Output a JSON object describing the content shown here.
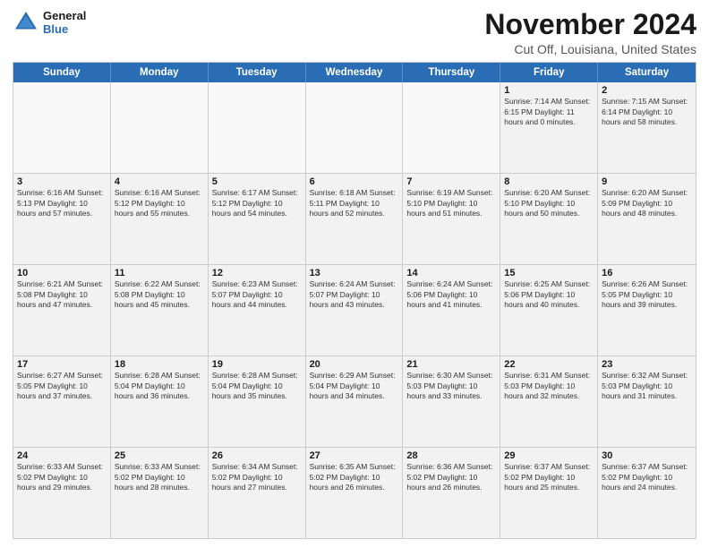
{
  "logo": {
    "line1": "General",
    "line2": "Blue"
  },
  "title": "November 2024",
  "subtitle": "Cut Off, Louisiana, United States",
  "headers": [
    "Sunday",
    "Monday",
    "Tuesday",
    "Wednesday",
    "Thursday",
    "Friday",
    "Saturday"
  ],
  "weeks": [
    [
      {
        "day": "",
        "detail": ""
      },
      {
        "day": "",
        "detail": ""
      },
      {
        "day": "",
        "detail": ""
      },
      {
        "day": "",
        "detail": ""
      },
      {
        "day": "",
        "detail": ""
      },
      {
        "day": "1",
        "detail": "Sunrise: 7:14 AM\nSunset: 6:15 PM\nDaylight: 11 hours\nand 0 minutes."
      },
      {
        "day": "2",
        "detail": "Sunrise: 7:15 AM\nSunset: 6:14 PM\nDaylight: 10 hours\nand 58 minutes."
      }
    ],
    [
      {
        "day": "3",
        "detail": "Sunrise: 6:16 AM\nSunset: 5:13 PM\nDaylight: 10 hours\nand 57 minutes."
      },
      {
        "day": "4",
        "detail": "Sunrise: 6:16 AM\nSunset: 5:12 PM\nDaylight: 10 hours\nand 55 minutes."
      },
      {
        "day": "5",
        "detail": "Sunrise: 6:17 AM\nSunset: 5:12 PM\nDaylight: 10 hours\nand 54 minutes."
      },
      {
        "day": "6",
        "detail": "Sunrise: 6:18 AM\nSunset: 5:11 PM\nDaylight: 10 hours\nand 52 minutes."
      },
      {
        "day": "7",
        "detail": "Sunrise: 6:19 AM\nSunset: 5:10 PM\nDaylight: 10 hours\nand 51 minutes."
      },
      {
        "day": "8",
        "detail": "Sunrise: 6:20 AM\nSunset: 5:10 PM\nDaylight: 10 hours\nand 50 minutes."
      },
      {
        "day": "9",
        "detail": "Sunrise: 6:20 AM\nSunset: 5:09 PM\nDaylight: 10 hours\nand 48 minutes."
      }
    ],
    [
      {
        "day": "10",
        "detail": "Sunrise: 6:21 AM\nSunset: 5:08 PM\nDaylight: 10 hours\nand 47 minutes."
      },
      {
        "day": "11",
        "detail": "Sunrise: 6:22 AM\nSunset: 5:08 PM\nDaylight: 10 hours\nand 45 minutes."
      },
      {
        "day": "12",
        "detail": "Sunrise: 6:23 AM\nSunset: 5:07 PM\nDaylight: 10 hours\nand 44 minutes."
      },
      {
        "day": "13",
        "detail": "Sunrise: 6:24 AM\nSunset: 5:07 PM\nDaylight: 10 hours\nand 43 minutes."
      },
      {
        "day": "14",
        "detail": "Sunrise: 6:24 AM\nSunset: 5:06 PM\nDaylight: 10 hours\nand 41 minutes."
      },
      {
        "day": "15",
        "detail": "Sunrise: 6:25 AM\nSunset: 5:06 PM\nDaylight: 10 hours\nand 40 minutes."
      },
      {
        "day": "16",
        "detail": "Sunrise: 6:26 AM\nSunset: 5:05 PM\nDaylight: 10 hours\nand 39 minutes."
      }
    ],
    [
      {
        "day": "17",
        "detail": "Sunrise: 6:27 AM\nSunset: 5:05 PM\nDaylight: 10 hours\nand 37 minutes."
      },
      {
        "day": "18",
        "detail": "Sunrise: 6:28 AM\nSunset: 5:04 PM\nDaylight: 10 hours\nand 36 minutes."
      },
      {
        "day": "19",
        "detail": "Sunrise: 6:28 AM\nSunset: 5:04 PM\nDaylight: 10 hours\nand 35 minutes."
      },
      {
        "day": "20",
        "detail": "Sunrise: 6:29 AM\nSunset: 5:04 PM\nDaylight: 10 hours\nand 34 minutes."
      },
      {
        "day": "21",
        "detail": "Sunrise: 6:30 AM\nSunset: 5:03 PM\nDaylight: 10 hours\nand 33 minutes."
      },
      {
        "day": "22",
        "detail": "Sunrise: 6:31 AM\nSunset: 5:03 PM\nDaylight: 10 hours\nand 32 minutes."
      },
      {
        "day": "23",
        "detail": "Sunrise: 6:32 AM\nSunset: 5:03 PM\nDaylight: 10 hours\nand 31 minutes."
      }
    ],
    [
      {
        "day": "24",
        "detail": "Sunrise: 6:33 AM\nSunset: 5:02 PM\nDaylight: 10 hours\nand 29 minutes."
      },
      {
        "day": "25",
        "detail": "Sunrise: 6:33 AM\nSunset: 5:02 PM\nDaylight: 10 hours\nand 28 minutes."
      },
      {
        "day": "26",
        "detail": "Sunrise: 6:34 AM\nSunset: 5:02 PM\nDaylight: 10 hours\nand 27 minutes."
      },
      {
        "day": "27",
        "detail": "Sunrise: 6:35 AM\nSunset: 5:02 PM\nDaylight: 10 hours\nand 26 minutes."
      },
      {
        "day": "28",
        "detail": "Sunrise: 6:36 AM\nSunset: 5:02 PM\nDaylight: 10 hours\nand 26 minutes."
      },
      {
        "day": "29",
        "detail": "Sunrise: 6:37 AM\nSunset: 5:02 PM\nDaylight: 10 hours\nand 25 minutes."
      },
      {
        "day": "30",
        "detail": "Sunrise: 6:37 AM\nSunset: 5:02 PM\nDaylight: 10 hours\nand 24 minutes."
      }
    ]
  ]
}
